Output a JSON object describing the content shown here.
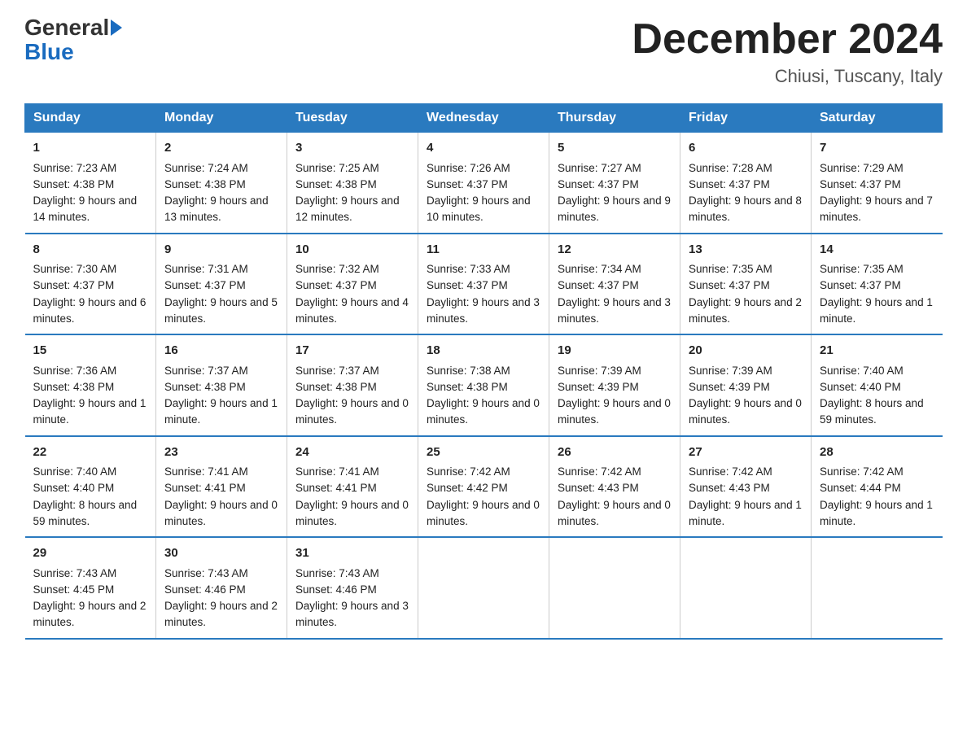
{
  "logo": {
    "general": "General",
    "blue": "Blue",
    "arrow": true
  },
  "title": "December 2024",
  "location": "Chiusi, Tuscany, Italy",
  "days_of_week": [
    "Sunday",
    "Monday",
    "Tuesday",
    "Wednesday",
    "Thursday",
    "Friday",
    "Saturday"
  ],
  "weeks": [
    [
      {
        "day": 1,
        "sunrise": "7:23 AM",
        "sunset": "4:38 PM",
        "daylight": "9 hours and 14 minutes."
      },
      {
        "day": 2,
        "sunrise": "7:24 AM",
        "sunset": "4:38 PM",
        "daylight": "9 hours and 13 minutes."
      },
      {
        "day": 3,
        "sunrise": "7:25 AM",
        "sunset": "4:38 PM",
        "daylight": "9 hours and 12 minutes."
      },
      {
        "day": 4,
        "sunrise": "7:26 AM",
        "sunset": "4:37 PM",
        "daylight": "9 hours and 10 minutes."
      },
      {
        "day": 5,
        "sunrise": "7:27 AM",
        "sunset": "4:37 PM",
        "daylight": "9 hours and 9 minutes."
      },
      {
        "day": 6,
        "sunrise": "7:28 AM",
        "sunset": "4:37 PM",
        "daylight": "9 hours and 8 minutes."
      },
      {
        "day": 7,
        "sunrise": "7:29 AM",
        "sunset": "4:37 PM",
        "daylight": "9 hours and 7 minutes."
      }
    ],
    [
      {
        "day": 8,
        "sunrise": "7:30 AM",
        "sunset": "4:37 PM",
        "daylight": "9 hours and 6 minutes."
      },
      {
        "day": 9,
        "sunrise": "7:31 AM",
        "sunset": "4:37 PM",
        "daylight": "9 hours and 5 minutes."
      },
      {
        "day": 10,
        "sunrise": "7:32 AM",
        "sunset": "4:37 PM",
        "daylight": "9 hours and 4 minutes."
      },
      {
        "day": 11,
        "sunrise": "7:33 AM",
        "sunset": "4:37 PM",
        "daylight": "9 hours and 3 minutes."
      },
      {
        "day": 12,
        "sunrise": "7:34 AM",
        "sunset": "4:37 PM",
        "daylight": "9 hours and 3 minutes."
      },
      {
        "day": 13,
        "sunrise": "7:35 AM",
        "sunset": "4:37 PM",
        "daylight": "9 hours and 2 minutes."
      },
      {
        "day": 14,
        "sunrise": "7:35 AM",
        "sunset": "4:37 PM",
        "daylight": "9 hours and 1 minute."
      }
    ],
    [
      {
        "day": 15,
        "sunrise": "7:36 AM",
        "sunset": "4:38 PM",
        "daylight": "9 hours and 1 minute."
      },
      {
        "day": 16,
        "sunrise": "7:37 AM",
        "sunset": "4:38 PM",
        "daylight": "9 hours and 1 minute."
      },
      {
        "day": 17,
        "sunrise": "7:37 AM",
        "sunset": "4:38 PM",
        "daylight": "9 hours and 0 minutes."
      },
      {
        "day": 18,
        "sunrise": "7:38 AM",
        "sunset": "4:38 PM",
        "daylight": "9 hours and 0 minutes."
      },
      {
        "day": 19,
        "sunrise": "7:39 AM",
        "sunset": "4:39 PM",
        "daylight": "9 hours and 0 minutes."
      },
      {
        "day": 20,
        "sunrise": "7:39 AM",
        "sunset": "4:39 PM",
        "daylight": "9 hours and 0 minutes."
      },
      {
        "day": 21,
        "sunrise": "7:40 AM",
        "sunset": "4:40 PM",
        "daylight": "8 hours and 59 minutes."
      }
    ],
    [
      {
        "day": 22,
        "sunrise": "7:40 AM",
        "sunset": "4:40 PM",
        "daylight": "8 hours and 59 minutes."
      },
      {
        "day": 23,
        "sunrise": "7:41 AM",
        "sunset": "4:41 PM",
        "daylight": "9 hours and 0 minutes."
      },
      {
        "day": 24,
        "sunrise": "7:41 AM",
        "sunset": "4:41 PM",
        "daylight": "9 hours and 0 minutes."
      },
      {
        "day": 25,
        "sunrise": "7:42 AM",
        "sunset": "4:42 PM",
        "daylight": "9 hours and 0 minutes."
      },
      {
        "day": 26,
        "sunrise": "7:42 AM",
        "sunset": "4:43 PM",
        "daylight": "9 hours and 0 minutes."
      },
      {
        "day": 27,
        "sunrise": "7:42 AM",
        "sunset": "4:43 PM",
        "daylight": "9 hours and 1 minute."
      },
      {
        "day": 28,
        "sunrise": "7:42 AM",
        "sunset": "4:44 PM",
        "daylight": "9 hours and 1 minute."
      }
    ],
    [
      {
        "day": 29,
        "sunrise": "7:43 AM",
        "sunset": "4:45 PM",
        "daylight": "9 hours and 2 minutes."
      },
      {
        "day": 30,
        "sunrise": "7:43 AM",
        "sunset": "4:46 PM",
        "daylight": "9 hours and 2 minutes."
      },
      {
        "day": 31,
        "sunrise": "7:43 AM",
        "sunset": "4:46 PM",
        "daylight": "9 hours and 3 minutes."
      },
      null,
      null,
      null,
      null
    ]
  ],
  "labels": {
    "sunrise": "Sunrise:",
    "sunset": "Sunset:",
    "daylight": "Daylight:"
  }
}
